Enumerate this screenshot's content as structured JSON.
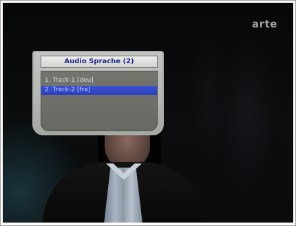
{
  "channel_logo": "arte",
  "audio_dialog": {
    "title": "Audio Sprache (2)",
    "tracks": [
      {
        "label": "1. Track-1 [deu]",
        "selected": false
      },
      {
        "label": "2. Track-2 [fra]",
        "selected": true
      }
    ]
  },
  "colors": {
    "title_text": "#1f2a88",
    "selection": "#2f46c6",
    "dialog_frame": "#b5b7b3",
    "list_background": "#6f706b"
  }
}
